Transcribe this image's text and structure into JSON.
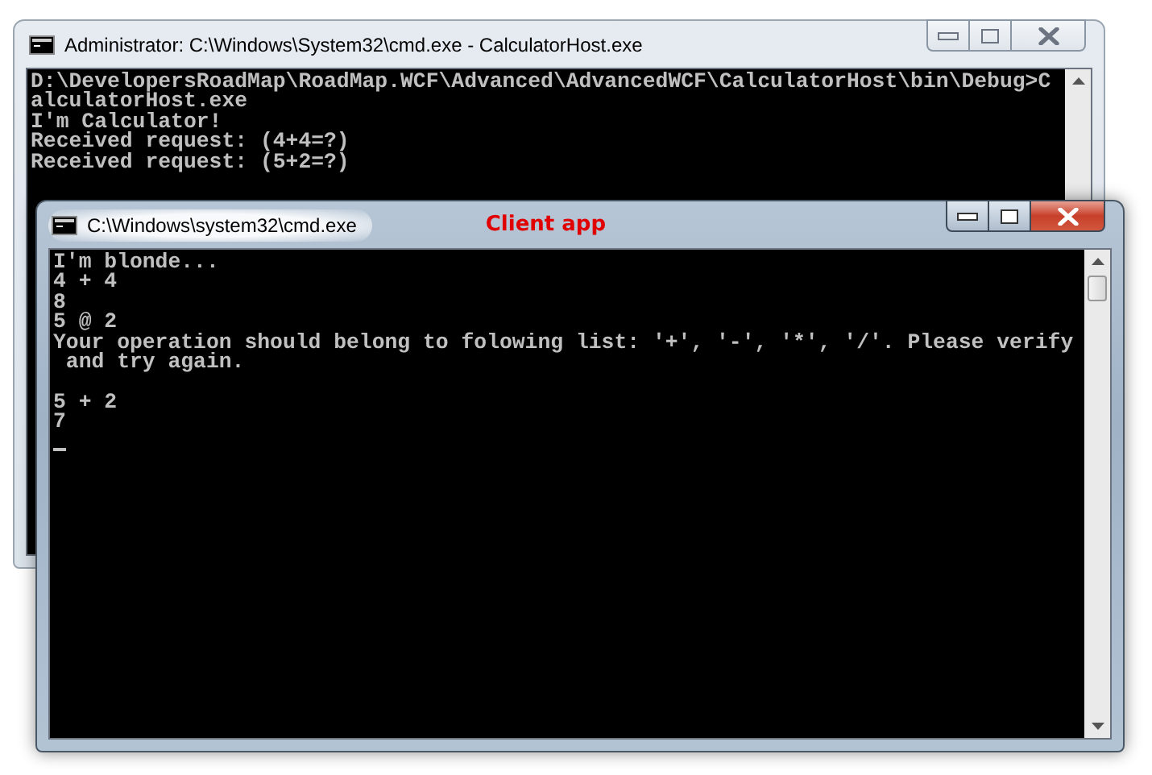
{
  "windows": [
    {
      "title": "Administrator: C:\\Windows\\System32\\cmd.exe - CalculatorHost.exe",
      "active": false,
      "blocks": [
        [
          "D:\\DevelopersRoadMap\\RoadMap.WCF\\Advanced\\AdvancedWCF\\CalculatorHost\\bin\\Debug>C",
          "alculatorHost.exe",
          "I'm Calculator!",
          "Received request: (4+4=?)",
          "Received request: (5+2=?)"
        ]
      ],
      "cursor": false
    },
    {
      "title": "C:\\Windows\\system32\\cmd.exe",
      "caption": "Client app",
      "active": true,
      "blocks": [
        [
          "I'm blonde...",
          "4 + 4",
          "8",
          "5 @ 2",
          "Your operation should belong to folowing list: '+', '-', '*', '/'. Please verify",
          " and try again."
        ],
        [
          "5 + 2",
          "7"
        ]
      ],
      "cursor": true
    }
  ]
}
